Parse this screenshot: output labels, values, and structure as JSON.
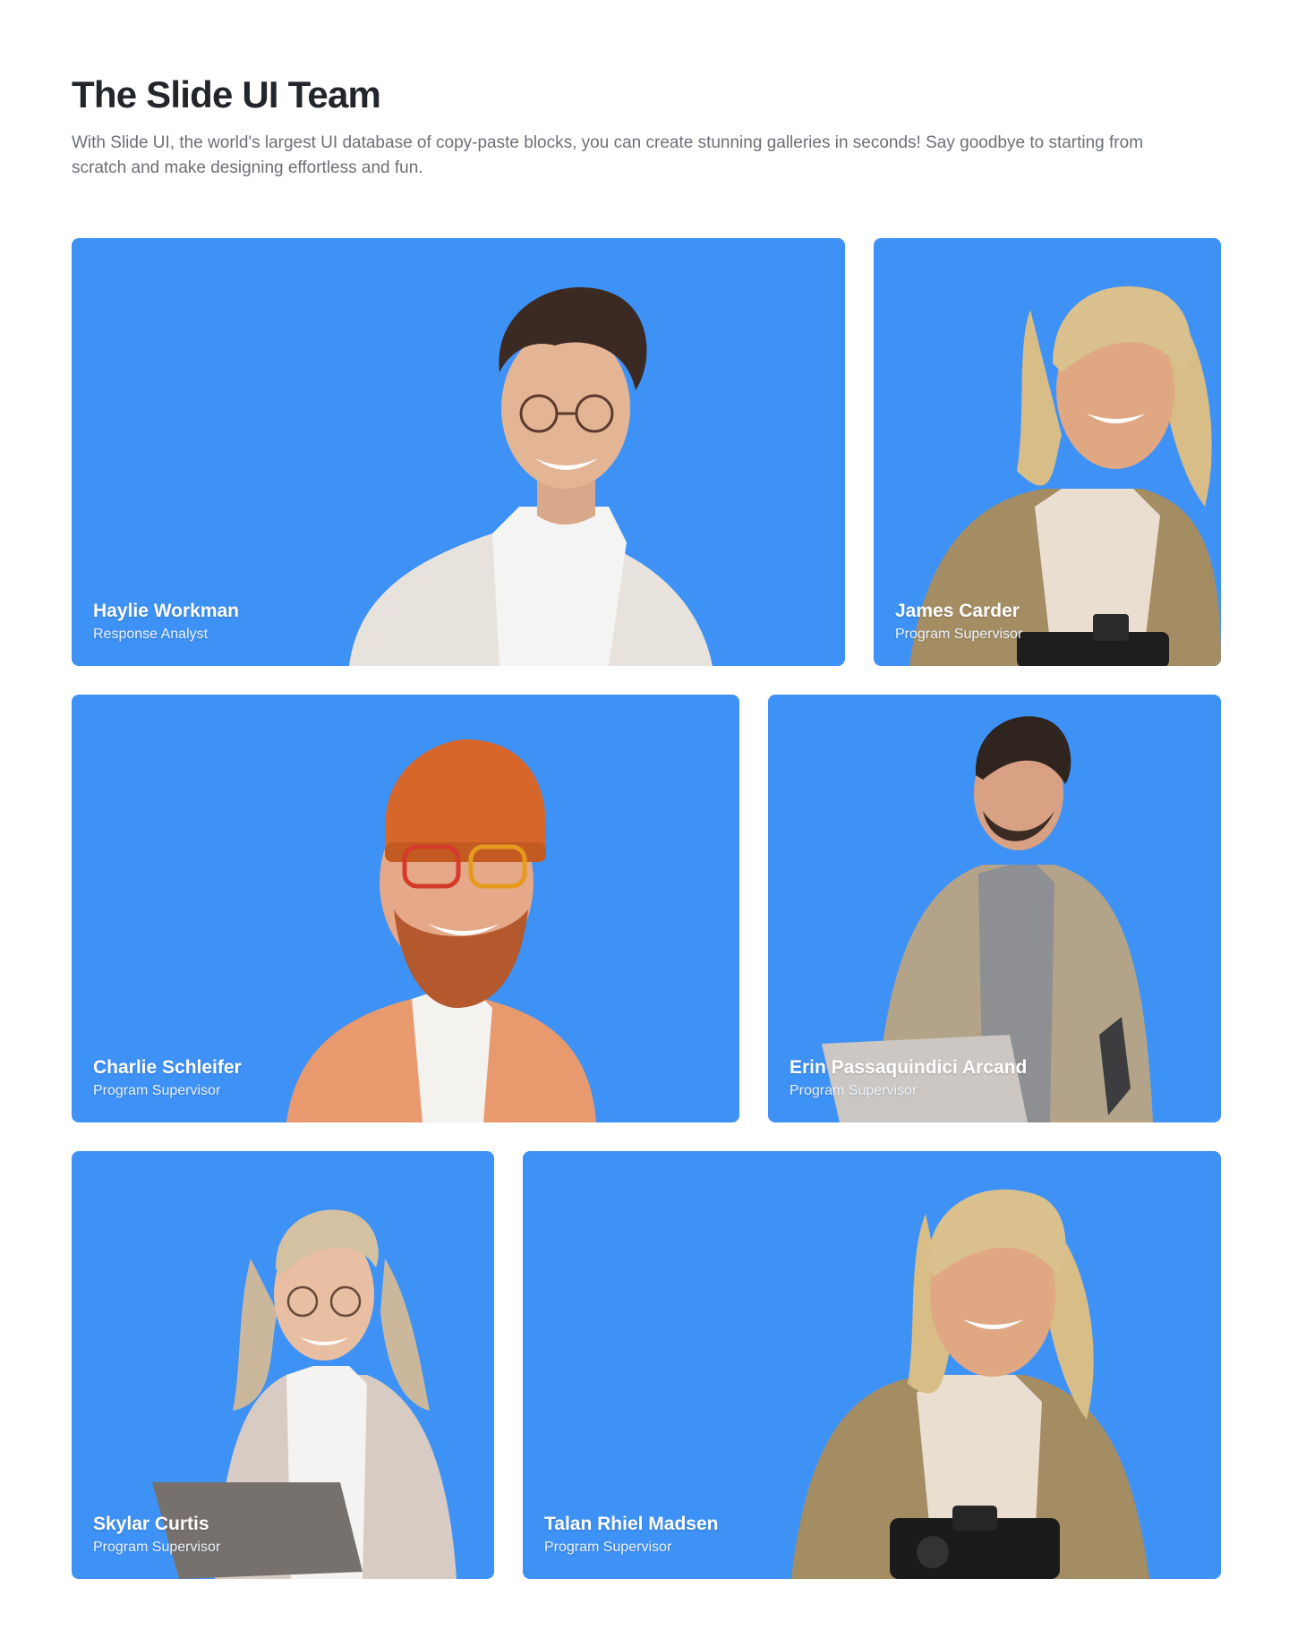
{
  "header": {
    "title": "The Slide UI Team",
    "description": "With Slide UI, the world's largest UI database of copy-paste blocks, you can create stunning galleries in seconds! Say goodbye to starting from scratch and make designing effortless and fun."
  },
  "colors": {
    "card_background": "#3f92f5",
    "title": "#22262b",
    "description": "#6b7077"
  },
  "team": [
    {
      "name": "Haylie Workman",
      "role": "Response Analyst",
      "photo": "man-glasses-white-jacket"
    },
    {
      "name": "James Carder",
      "role": "Program Supervisor",
      "photo": "blonde-woman-camera"
    },
    {
      "name": "Charlie Schleifer",
      "role": "Program Supervisor",
      "photo": "bearded-man-orange-beanie"
    },
    {
      "name": "Erin Passaquindici Arcand",
      "role": "Program Supervisor",
      "photo": "man-laptop-khaki-jacket"
    },
    {
      "name": "Skylar Curtis",
      "role": "Program Supervisor",
      "photo": "woman-glasses-laptop"
    },
    {
      "name": "Talan Rhiel Madsen",
      "role": "Program Supervisor",
      "photo": "blonde-woman-camera"
    }
  ]
}
